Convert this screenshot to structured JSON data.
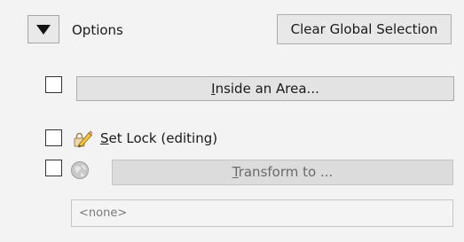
{
  "options": {
    "label": "Options",
    "clear_button": "Clear Global Selection"
  },
  "inside_area": {
    "checked": false,
    "mnemonic": "I",
    "label_rest": "nside an Area..."
  },
  "set_lock": {
    "checked": false,
    "icon": "pencil-lock-icon",
    "mnemonic": "S",
    "label_rest": "et Lock (editing)"
  },
  "transform": {
    "checked": false,
    "enabled": false,
    "icon": "globe-icon",
    "mnemonic": "T",
    "label_rest": "ransform to ..."
  },
  "target_field": {
    "value": "<none>"
  }
}
